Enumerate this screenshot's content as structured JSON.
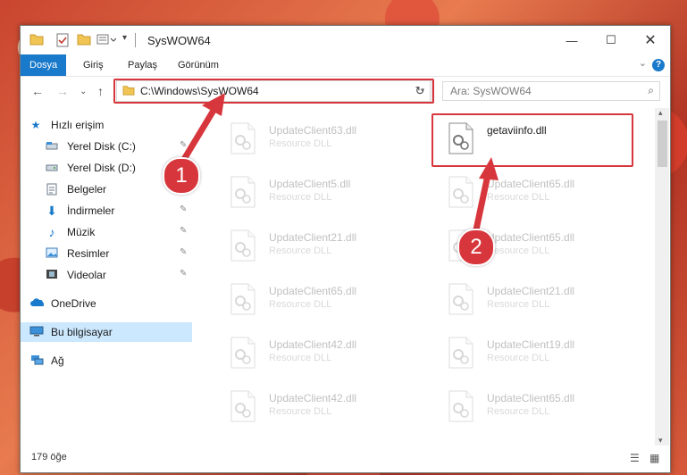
{
  "window": {
    "title": "SysWOW64"
  },
  "ribbon": {
    "tabs": [
      "Dosya",
      "Giriş",
      "Paylaş",
      "Görünüm"
    ],
    "help": "?"
  },
  "nav": {
    "address": "C:\\Windows\\SysWOW64",
    "search_placeholder": "Ara: SysWOW64"
  },
  "sidebar": {
    "items": [
      {
        "label": "Hızlı erişim",
        "icon": "star-icon"
      },
      {
        "label": "Yerel Disk (C:)",
        "icon": "drive-icon"
      },
      {
        "label": "Yerel Disk (D:)",
        "icon": "drive-icon"
      },
      {
        "label": "Belgeler",
        "icon": "documents-icon"
      },
      {
        "label": "İndirmeler",
        "icon": "download-icon"
      },
      {
        "label": "Müzik",
        "icon": "music-icon"
      },
      {
        "label": "Resimler",
        "icon": "pictures-icon"
      },
      {
        "label": "Videolar",
        "icon": "video-icon"
      },
      {
        "label": "OneDrive",
        "icon": "cloud-icon"
      },
      {
        "label": "Bu bilgisayar",
        "icon": "computer-icon"
      },
      {
        "label": "Ağ",
        "icon": "network-icon"
      }
    ]
  },
  "files": [
    {
      "name": "UpdateClient63.dll",
      "type": "Resource DLL"
    },
    {
      "name": "getaviinfo.dll",
      "type": ""
    },
    {
      "name": "UpdateClient5.dll",
      "type": "Resource DLL"
    },
    {
      "name": "UpdateClient65.dll",
      "type": "Resource DLL"
    },
    {
      "name": "UpdateClient21.dll",
      "type": "Resource DLL"
    },
    {
      "name": "UpdateClient65.dll",
      "type": "Resource DLL"
    },
    {
      "name": "UpdateClient65.dll",
      "type": "Resource DLL"
    },
    {
      "name": "UpdateClient21.dll",
      "type": "Resource DLL"
    },
    {
      "name": "UpdateClient42.dll",
      "type": "Resource DLL"
    },
    {
      "name": "UpdateClient19.dll",
      "type": "Resource DLL"
    },
    {
      "name": "UpdateClient42.dll",
      "type": "Resource DLL"
    },
    {
      "name": "UpdateClient65.dll",
      "type": "Resource DLL"
    }
  ],
  "status": {
    "count": "179 öğe"
  },
  "annotations": {
    "step1": "1",
    "step2": "2"
  },
  "colors": {
    "accent": "#1979ca",
    "highlight": "#d7373c",
    "selected": "#cce8ff"
  }
}
